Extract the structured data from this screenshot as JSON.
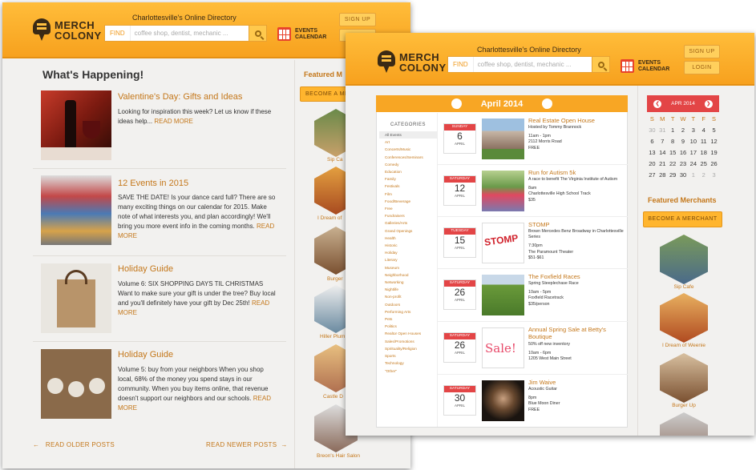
{
  "back": {
    "header": {
      "tagline": "Charlottesville's Online Directory",
      "logo_line1": "MERCH",
      "logo_line2": "COLONY",
      "search_label": "FIND",
      "search_placeholder": "coffee shop, dentist, mechanic ...",
      "events_line1": "EVENTS",
      "events_line2": "CALENDAR",
      "signup": "SIGN UP"
    },
    "heading": "What's Happening!",
    "posts": [
      {
        "title": "Valentine's Day: Gifts and Ideas",
        "body": "Looking for inspiration this week? Let us know if these ideas help...",
        "more": "READ MORE",
        "image": "wine-photo"
      },
      {
        "title": "12 Events in 2015",
        "body": "SAVE THE DATE! Is your dance card full? There are so many exciting things on our calendar for 2015. Make note of what interests you, and plan accordingly! We'll bring you more event info in the coming months.",
        "more": "READ MORE",
        "image": "street-festival-photo"
      },
      {
        "title": "Holiday Guide",
        "body": "Volume 6: SIX SHOPPING DAYS TIL CHRISTMAS Want to make sure your gift is under the tree? Buy local and you'll definitely have your gift by Dec 25th!",
        "more": "READ MORE",
        "image": "tote-bag-photo"
      },
      {
        "title": "Holiday Guide",
        "body": "Volume 5: buy from your neighbors When you shop local, 68% of the money you spend stays in our community. When you buy items online, that revenue doesn't support our neighbors and our schools.",
        "more": "READ MORE",
        "image": "clay-ornaments-photo"
      }
    ],
    "older": "READ OLDER POSTS",
    "newer": "READ NEWER POSTS",
    "featured": "Featured M",
    "become": "BECOME A ME",
    "merchants": [
      "Sip Ca",
      "I Dream of",
      "Burger",
      "Hiller Plum",
      "Castle D",
      "Breon's Hair Salon"
    ]
  },
  "front": {
    "header": {
      "tagline": "Charlottesville's Online Directory",
      "logo_line1": "MERCH",
      "logo_line2": "COLONY",
      "search_label": "FIND",
      "search_placeholder": "coffee shop, dentist, mechanic ...",
      "events_line1": "EVENTS",
      "events_line2": "CALENDAR",
      "signup": "SIGN UP",
      "login": "LOGIN"
    },
    "month": "April 2014",
    "categories_title": "CATEGORIES",
    "categories": [
      "All Events",
      "Art",
      "Concerts/Music",
      "Conferences/Seminars",
      "Comedy",
      "Education",
      "Family",
      "Festivals",
      "Film",
      "Food/Beverage",
      "Free",
      "Fundraisers",
      "Galleries/Arts",
      "Grand Openings",
      "Health",
      "Historic",
      "Holiday",
      "Literary",
      "Museum",
      "Neighborhood",
      "Networking",
      "Nightlife",
      "Non-profit",
      "Outdoors",
      "Performing Arts",
      "Pets",
      "Politics",
      "Realtor Open Houses",
      "Sales/Promotions",
      "Spirituality/Religion",
      "Sports",
      "Technology",
      "\"Other\""
    ],
    "events": [
      {
        "day": "SUNDAY",
        "num": "6",
        "mon": "APRIL",
        "title": "Real Estate Open House",
        "details": [
          "Hosted by Tommy Brannock",
          "",
          "11am - 1pm",
          "2112 Morris Road",
          "FREE"
        ],
        "image": "house-photo"
      },
      {
        "day": "SATURDAY",
        "num": "12",
        "mon": "APRIL",
        "title": "Run for Autism 5k",
        "details": [
          "A race to benefit The Virginia Institute of Autism",
          "",
          "8am",
          "Charlottesville High School Track",
          "$35"
        ],
        "image": "runners-photo"
      },
      {
        "day": "TUESDAY",
        "num": "15",
        "mon": "APRIL",
        "title": "STOMP",
        "details": [
          "Brown Mercedes Benz Broadway in Charlottesville Series",
          "",
          "7:30pm",
          "The Paramount Theater",
          "$51-$61"
        ],
        "image": "stomp-logo"
      },
      {
        "day": "SATURDAY",
        "num": "26",
        "mon": "APRIL",
        "title": "The Foxfield Races",
        "details": [
          "Spring Steeplechase Race",
          "",
          "10am - 5pm",
          "Foxfield Racetrack",
          "$35/person"
        ],
        "image": "horse-race-photo"
      },
      {
        "day": "SATURDAY",
        "num": "26",
        "mon": "APRIL",
        "title": "Annual Spring Sale at Betty's Boutique",
        "details": [
          "50% off new inventory",
          "",
          "10am - 6pm",
          "1205 West Main Street"
        ],
        "image": "sale-sign"
      },
      {
        "day": "SATURDAY",
        "num": "30",
        "mon": "APRIL",
        "title": "Jim Waive",
        "details": [
          "Acoustic Guitar",
          "",
          "8pm",
          "Blue Moon Diner",
          "FREE"
        ],
        "image": "musician-photo"
      }
    ],
    "mini_cal": {
      "month": "APR 2014",
      "weekdays": [
        "S",
        "M",
        "T",
        "W",
        "T",
        "F",
        "S"
      ],
      "days": [
        "30",
        "31",
        "1",
        "2",
        "3",
        "4",
        "5",
        "6",
        "7",
        "8",
        "9",
        "10",
        "11",
        "12",
        "13",
        "14",
        "15",
        "16",
        "17",
        "18",
        "19",
        "20",
        "21",
        "22",
        "23",
        "24",
        "25",
        "26",
        "27",
        "28",
        "29",
        "30",
        "1",
        "2",
        "3"
      ]
    },
    "featured": "Featured Merchants",
    "become": "BECOME A MERCHANT",
    "merchants": [
      "Sip Cafe",
      "I Dream of Weenie",
      "Burger Up"
    ]
  }
}
